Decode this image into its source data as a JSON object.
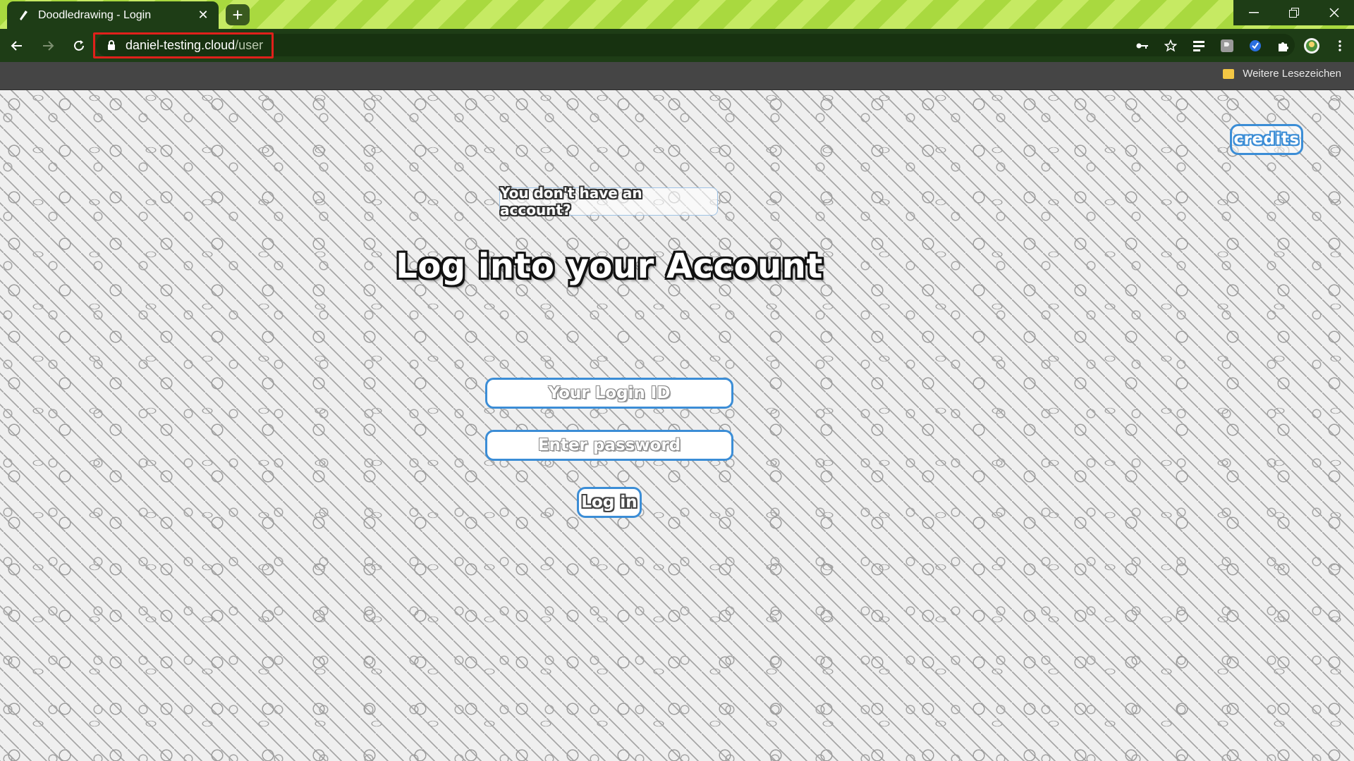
{
  "browser": {
    "tab_title": "Doodledrawing - Login",
    "url_host": "daniel-testing.cloud",
    "url_path": "/user",
    "bookmarks_other": "Weitere Lesezeichen",
    "accent": "#1e3d16",
    "highlight_color": "#e0201b"
  },
  "page": {
    "credits_label": "credits",
    "signup_link": "You don't have an account?",
    "heading": "Log into your Account",
    "login_placeholder": "Your Login ID",
    "password_placeholder": "Enter password",
    "login_button": "Log in",
    "accent": "#3b8dd6"
  }
}
